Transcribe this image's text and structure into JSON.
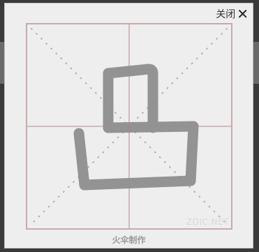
{
  "popup": {
    "close_label": "关闭",
    "close_icon_glyph": "✕",
    "character": "凸",
    "watermark": "ZDIC.NET",
    "credit": "火伞制作"
  },
  "colors": {
    "grid_line": "#c9a9ab",
    "guide_dots": "#b0b0b0",
    "glyph": "#8f8f8f",
    "popup_bg": "#eeeeee"
  }
}
